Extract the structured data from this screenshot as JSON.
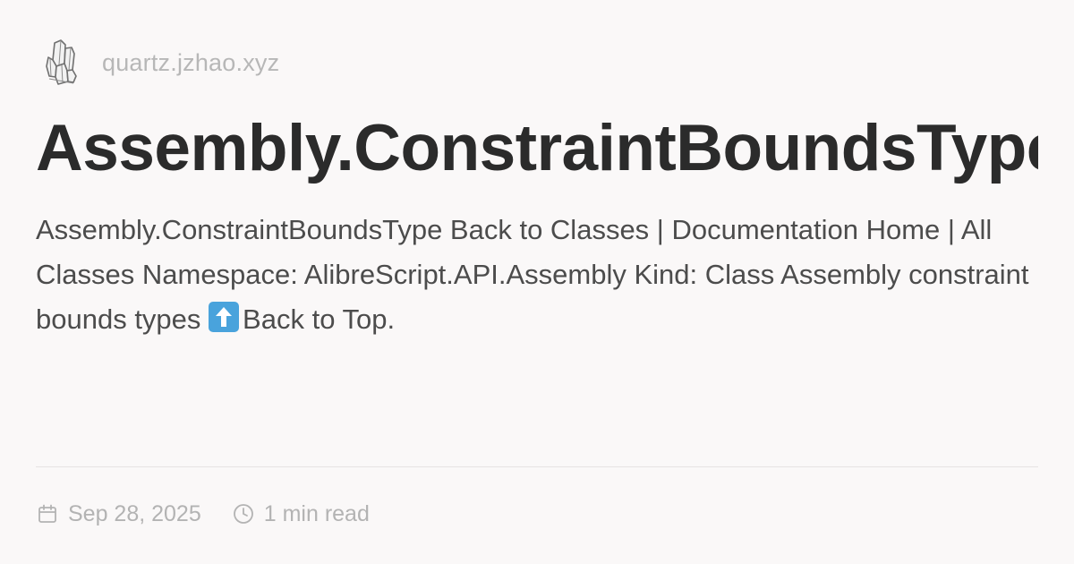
{
  "site": {
    "logo_icon": "crystal-icon",
    "name": "quartz.jzhao.xyz"
  },
  "page": {
    "title": "Assembly.ConstraintBoundsType",
    "description_part1": "Assembly.ConstraintBoundsType Back to Classes | Documentation Home | All Classes Namespace: AlibreScript.API.Assembly Kind: Class Assembly constraint bounds types",
    "description_part2": "Back to Top."
  },
  "meta": {
    "date": "Sep 28, 2025",
    "read_time": "1 min read",
    "date_icon": "calendar-icon",
    "time_icon": "clock-icon"
  }
}
